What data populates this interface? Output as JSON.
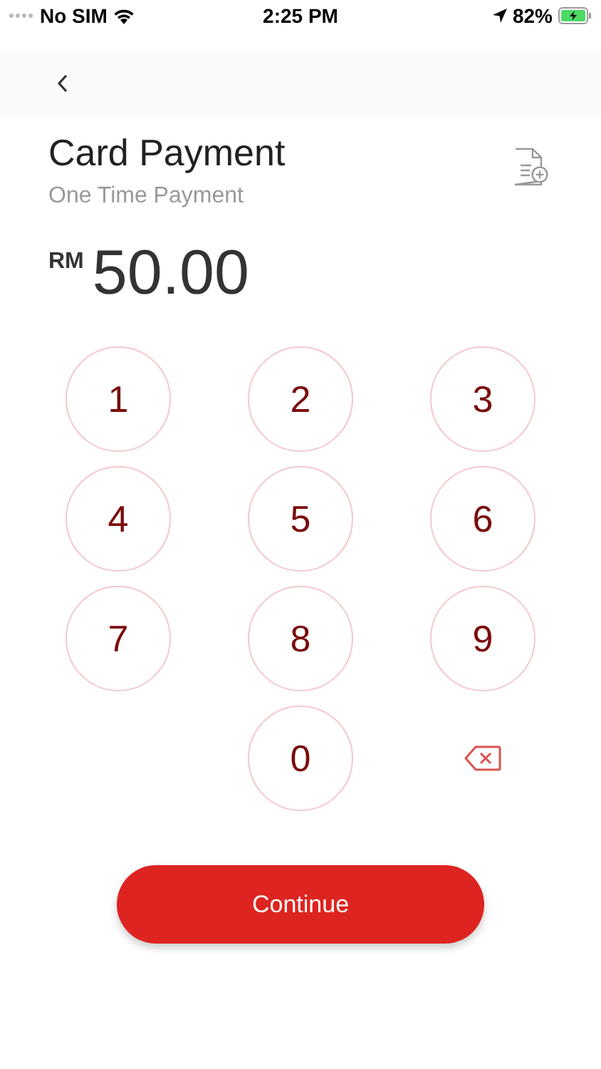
{
  "status_bar": {
    "carrier": "No SIM",
    "time": "2:25 PM",
    "battery": "82%"
  },
  "header": {
    "title": "Card Payment",
    "subtitle": "One Time Payment"
  },
  "amount": {
    "currency": "RM",
    "value": "50.00"
  },
  "keypad": [
    {
      "kind": "digit",
      "label": "1"
    },
    {
      "kind": "digit",
      "label": "2"
    },
    {
      "kind": "digit",
      "label": "3"
    },
    {
      "kind": "digit",
      "label": "4"
    },
    {
      "kind": "digit",
      "label": "5"
    },
    {
      "kind": "digit",
      "label": "6"
    },
    {
      "kind": "digit",
      "label": "7"
    },
    {
      "kind": "digit",
      "label": "8"
    },
    {
      "kind": "digit",
      "label": "9"
    },
    {
      "kind": "empty"
    },
    {
      "kind": "digit",
      "label": "0"
    },
    {
      "kind": "backspace"
    }
  ],
  "continue_button": {
    "label": "Continue"
  }
}
